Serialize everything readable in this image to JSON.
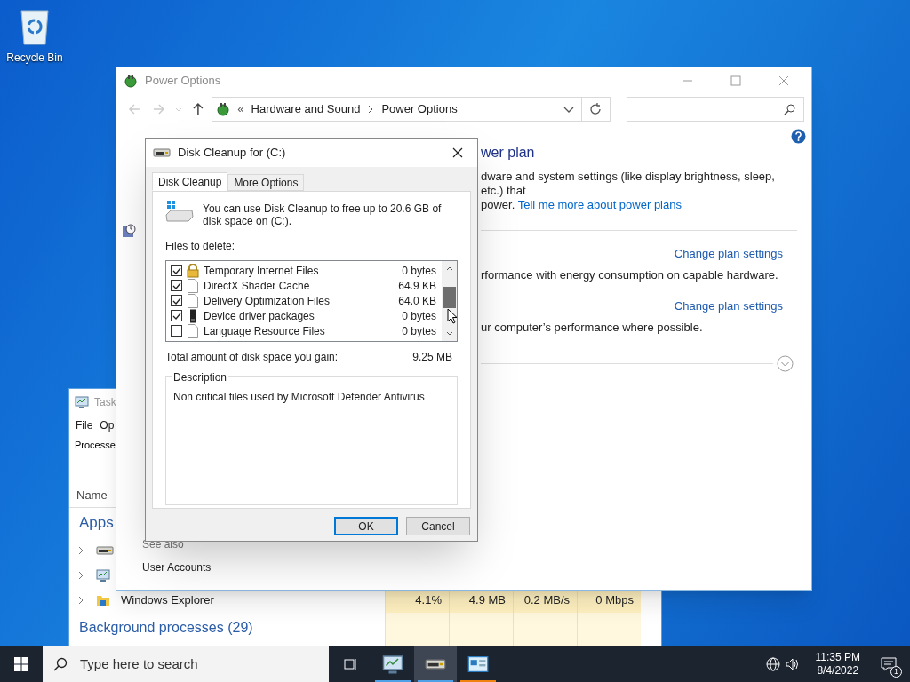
{
  "desktop_icons": [
    {
      "label": "Recycle Bin"
    }
  ],
  "task_manager": {
    "title": "Task",
    "menu": [
      "File",
      "Op"
    ],
    "tab": "Processe",
    "column": "Name",
    "apps_group": "Apps",
    "app_rows": [
      {
        "kind": "disk-cleanup"
      },
      {
        "kind": "task-manager"
      }
    ],
    "row": {
      "name": "Windows Explorer",
      "cells": [
        "4.1%",
        "4.9 MB",
        "0.2 MB/s",
        "0 Mbps"
      ]
    },
    "background_group": "Background processes (29)"
  },
  "power_options": {
    "title": "Power Options",
    "address": {
      "prefix": "«",
      "crumbs": [
        "Hardware and Sound",
        "Power Options"
      ]
    },
    "heading": "wer plan",
    "intro": "dware and system settings (like display brightness, sleep, etc.) that",
    "intro_end": "power.",
    "intro_link": "Tell me more about power plans",
    "plans": [
      {
        "link": "Change plan settings",
        "description": "rformance with energy consumption on capable hardware."
      },
      {
        "link": "Change plan settings",
        "description": "ur computer’s performance where possible."
      }
    ],
    "see_also": "See also",
    "see_also_links": [
      "User Accounts"
    ]
  },
  "disk_cleanup": {
    "title": "Disk Cleanup for  (C:)",
    "tabs": [
      {
        "label": "Disk Cleanup",
        "selected": true
      },
      {
        "label": "More Options",
        "selected": false
      }
    ],
    "message": "You can use Disk Cleanup to free up to 20.6 GB of disk space on  (C:).",
    "files_label": "Files to delete:",
    "files": [
      {
        "name": "Temporary Internet Files",
        "size": "0 bytes",
        "checked": true,
        "kind": "lock"
      },
      {
        "name": "DirectX Shader Cache",
        "size": "64.9 KB",
        "checked": true,
        "kind": "file"
      },
      {
        "name": "Delivery Optimization Files",
        "size": "64.0 KB",
        "checked": true,
        "kind": "file"
      },
      {
        "name": "Device driver packages",
        "size": "0 bytes",
        "checked": true,
        "kind": "device"
      },
      {
        "name": "Language Resource Files",
        "size": "0 bytes",
        "checked": false,
        "kind": "file"
      }
    ],
    "total_label": "Total amount of disk space you gain:",
    "total": "9.25 MB",
    "description_label": "Description",
    "description": "Non critical files used by Microsoft Defender Antivirus",
    "buttons": [
      {
        "label": "OK",
        "default": true
      },
      {
        "label": "Cancel",
        "default": false
      }
    ]
  },
  "taskbar": {
    "search_placeholder": "Type here to search",
    "apps": [
      {
        "kind": "task-manager",
        "selected": false,
        "color": "#4ea1e6"
      },
      {
        "kind": "disk-cleanup",
        "selected": true,
        "color": "#4ea1e6"
      },
      {
        "kind": "control-panel",
        "selected": false,
        "color": "#f0820f"
      }
    ],
    "time": "11:35 PM",
    "date": "8/4/2022",
    "notifications": "1"
  }
}
